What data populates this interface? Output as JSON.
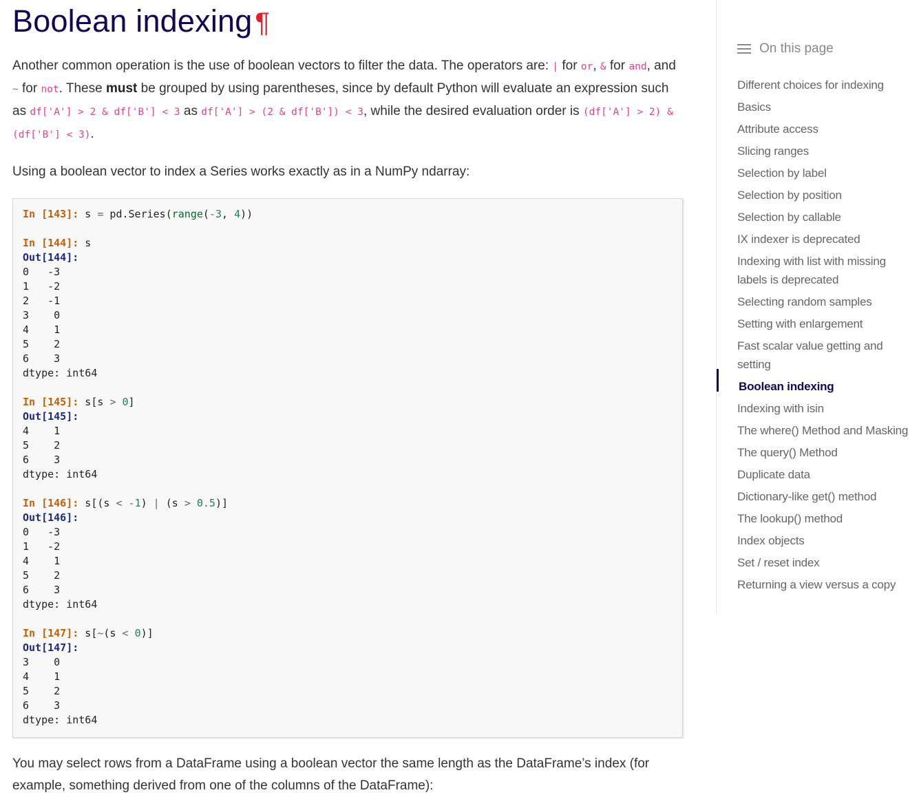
{
  "page": {
    "title": "Boolean indexing",
    "pilcrow": "¶"
  },
  "intro": {
    "t1": "Another common operation is the use of boolean vectors to filter the data. The operators are: ",
    "op_or": "|",
    "t2": " for ",
    "code_or": "or",
    "t3": ", ",
    "op_and": "&",
    "t4": " for ",
    "code_and": "and",
    "t5": ", and",
    "op_not": "~",
    "t6": " for ",
    "code_not": "not",
    "t7": ". These ",
    "must": "must",
    "t8": " be grouped by using parentheses, since by default Python will evaluate an expression such as ",
    "expr1": "df['A'] > 2 & df['B'] < 3",
    "t9": " as ",
    "expr2": "df['A'] > (2 & df['B']) < 3",
    "t10": ", while the desired evaluation order is ",
    "expr3": "(df['A'] > 2) & (df['B'] < 3)",
    "t11": "."
  },
  "series_para": "Using a boolean vector to index a Series works exactly as in a NumPy ndarray:",
  "code": {
    "in143": "In [143]:",
    "in143_code": " s = pd.Series(range(-3, 4))",
    "in144": "In [144]:",
    "in144_code": " s",
    "out144": "Out[144]:",
    "out144_rows": [
      "0   -3",
      "1   -2",
      "2   -1",
      "3    0",
      "4    1",
      "5    2",
      "6    3"
    ],
    "dtype": "dtype: int64",
    "in145": "In [145]:",
    "in145_code": " s[s > 0]",
    "out145": "Out[145]:",
    "out145_rows": [
      "4    1",
      "5    2",
      "6    3"
    ],
    "in146": "In [146]:",
    "in146_code": " s[(s < -1) | (s > 0.5)]",
    "out146": "Out[146]:",
    "out146_rows": [
      "0   -3",
      "1   -2",
      "4    1",
      "5    2",
      "6    3"
    ],
    "in147": "In [147]:",
    "in147_code": " s[~(s < 0)]",
    "out147": "Out[147]:",
    "out147_rows": [
      "3    0",
      "4    1",
      "5    2",
      "6    3"
    ]
  },
  "dataframe_para": "You may select rows from a DataFrame using a boolean vector the same length as the DataFrame’s index (for example, something derived from one of the columns of the DataFrame):",
  "sidebar": {
    "heading": "On this page",
    "icon": "list-icon",
    "items": [
      "Different choices for indexing",
      "Basics",
      "Attribute access",
      "Slicing ranges",
      "Selection by label",
      "Selection by position",
      "Selection by callable",
      "IX indexer is deprecated",
      "Indexing with list with missing labels is deprecated",
      "Selecting random samples",
      "Setting with enlargement",
      "Fast scalar value getting and setting",
      "Boolean indexing",
      "Indexing with isin",
      "The where() Method and Masking",
      "The query() Method",
      "Duplicate data",
      "Dictionary-like get() method",
      "The lookup() method",
      "Index objects",
      "Set / reset index",
      "Returning a view versus a copy"
    ],
    "active_index": 12
  },
  "colors": {
    "title": "#130654",
    "pilcrow": "#e11e2a",
    "inline_code": "#e83e8c",
    "prompt_in": "#c65d09",
    "prompt_out": "#1e2a80"
  }
}
